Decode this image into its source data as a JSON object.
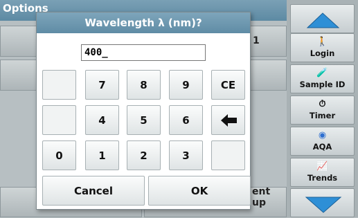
{
  "screen": {
    "title": "Options",
    "bg_right_top_text": "1",
    "bg_bottom_right_text": "ent\nup"
  },
  "sidebar": {
    "items": [
      {
        "label": "Login",
        "icon": "person-icon",
        "glyph": "🚶"
      },
      {
        "label": "Sample ID",
        "icon": "vial-icon",
        "glyph": "🧪"
      },
      {
        "label": "Timer",
        "icon": "timer-icon",
        "glyph": "⏱"
      },
      {
        "label": "AQA",
        "icon": "aqa-icon",
        "glyph": "◉"
      },
      {
        "label": "Trends",
        "icon": "trends-icon",
        "glyph": "📈"
      }
    ]
  },
  "dialog": {
    "title": "Wavelength λ (nm)?",
    "input_value": "400_",
    "keys": {
      "k7": "7",
      "k8": "8",
      "k9": "9",
      "ce": "CE",
      "k4": "4",
      "k5": "5",
      "k6": "6",
      "back_glyph": "🡐",
      "k0": "0",
      "k1": "1",
      "k2": "2",
      "k3": "3"
    },
    "cancel_label": "Cancel",
    "ok_label": "OK"
  },
  "colors": {
    "title_bar": "#6b95ac",
    "dialog_bg": "#ffffff",
    "key_bg": "#eef1f1"
  }
}
